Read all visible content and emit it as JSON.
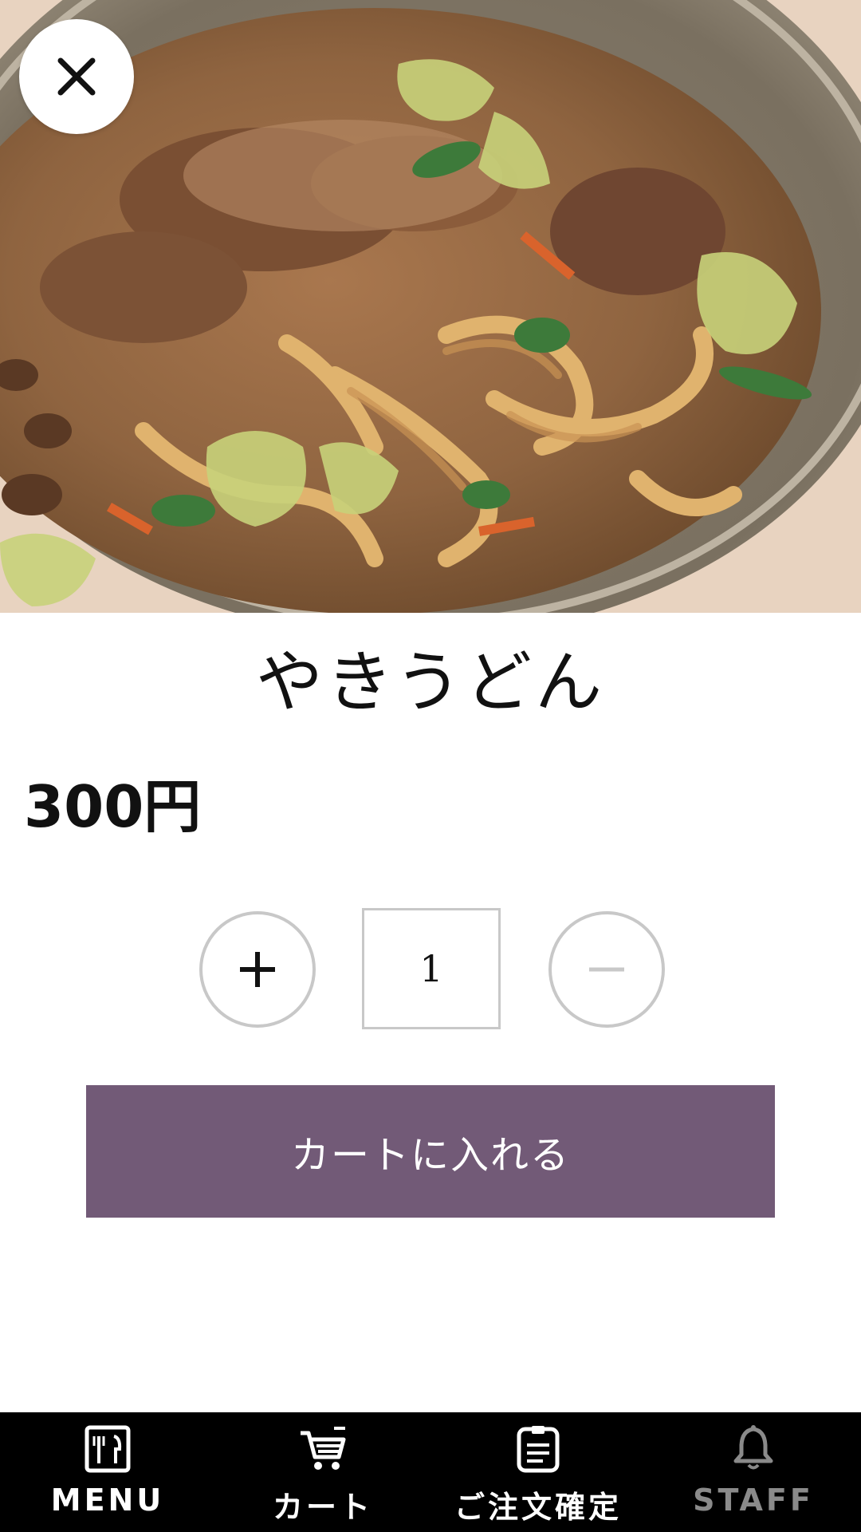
{
  "product": {
    "name": "やきうどん",
    "price": "300円"
  },
  "quantity": {
    "value": "1",
    "increment_symbol": "+",
    "decrement_symbol": "−"
  },
  "actions": {
    "add_to_cart_label": "カートに入れる",
    "close_icon": "close-icon"
  },
  "bottom_nav": {
    "items": [
      {
        "label": "MENU",
        "icon": "menu-icon"
      },
      {
        "label": "カート",
        "icon": "cart-icon"
      },
      {
        "label": "ご注文確定",
        "icon": "order-confirm-icon"
      },
      {
        "label": "STAFF",
        "icon": "bell-icon"
      }
    ]
  },
  "colors": {
    "accent": "#725a77",
    "nav_background": "#000000",
    "stepper_border": "#c8c8c8",
    "muted_nav": "#8a8a8a"
  }
}
